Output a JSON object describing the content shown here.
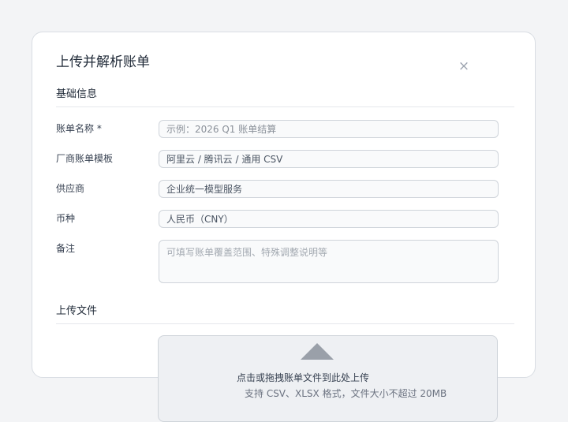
{
  "dialog": {
    "title": "上传并解析账单",
    "close_symbol": "×",
    "close_icon": "close-icon"
  },
  "sections": {
    "basic_info": "基础信息",
    "upload_file": "上传文件"
  },
  "fields": {
    "bill_name": {
      "label": "账单名称 *",
      "value": "",
      "placeholder": "示例：2026 Q1 账单结算"
    },
    "vendor_template": {
      "label": "厂商账单模板",
      "value": "阿里云 / 腾讯云 / 通用 CSV",
      "placeholder": ""
    },
    "supplier": {
      "label": "供应商",
      "value": "企业统一模型服务",
      "placeholder": ""
    },
    "currency": {
      "label": "币种",
      "value": "人民币（CNY）",
      "placeholder": ""
    },
    "notes": {
      "label": "备注",
      "value": "",
      "placeholder": "可填写账单覆盖范围、特殊调整说明等"
    }
  },
  "upload": {
    "main_text": "点击或拖拽账单文件到此处上传",
    "hint_text": "支持 CSV、XLSX 格式，文件大小不超过 20MB",
    "icon": "upload-arrow-icon"
  },
  "colors": {
    "background": "#f3f4f6",
    "dialog": "#ffffff",
    "border": "#d9dde3",
    "input_bg": "#f9fafb",
    "dropzone_bg": "#eef0f3",
    "icon": "#9aa0a9"
  }
}
